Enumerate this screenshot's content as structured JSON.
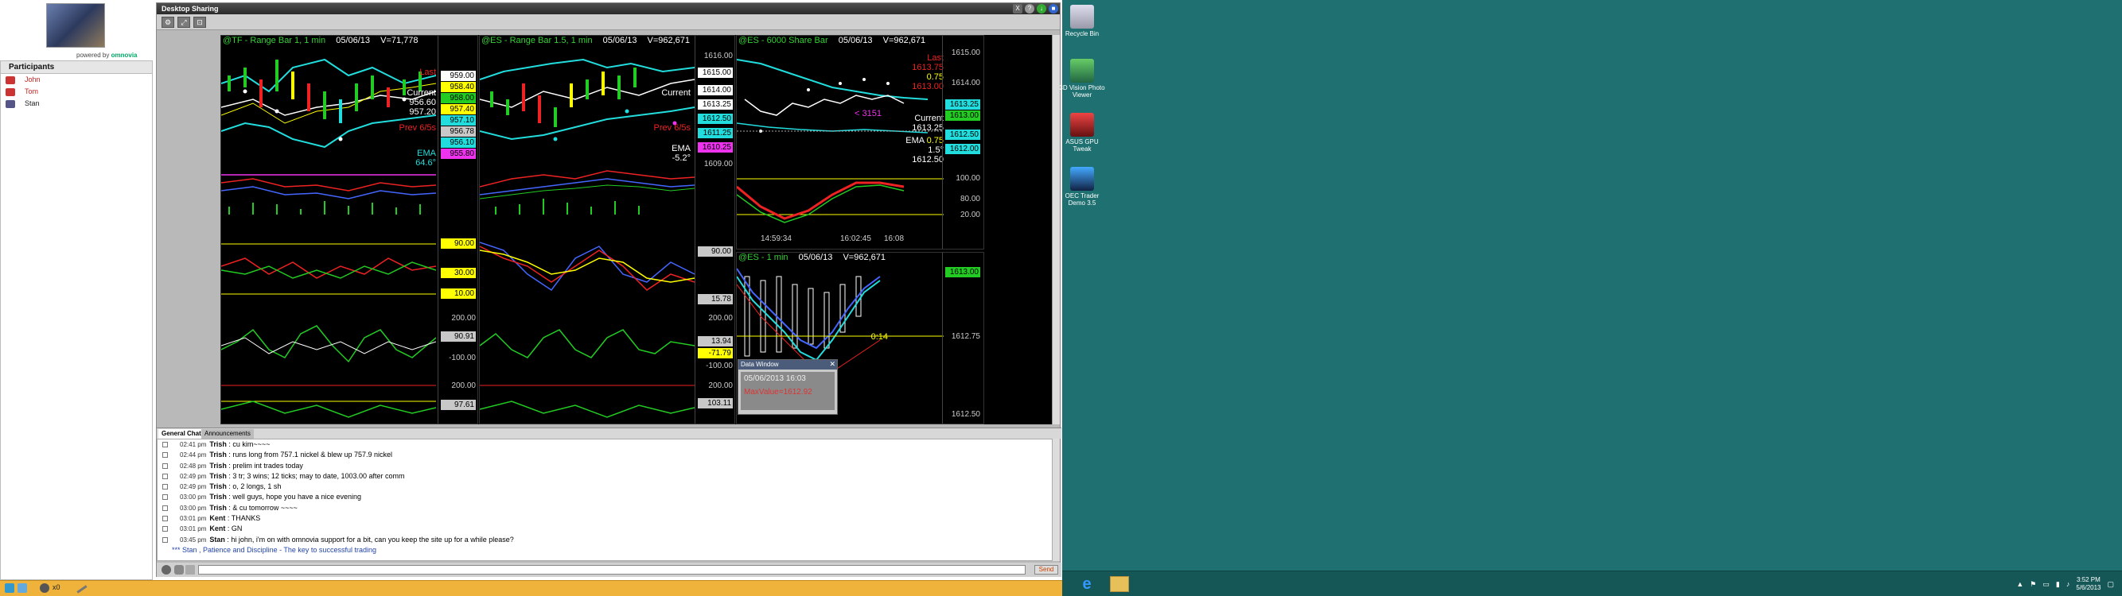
{
  "app": {
    "powered_prefix": "powered by",
    "powered_brand": "omnovia",
    "participants_title": "Participants",
    "participants": [
      {
        "name": "John",
        "color": "#cc2222"
      },
      {
        "name": "Tom",
        "color": "#cc2222"
      },
      {
        "name": "Stan",
        "color": "#222222"
      }
    ]
  },
  "share": {
    "title": "Desktop Sharing",
    "controls": [
      "X",
      "?",
      "↓",
      "■"
    ]
  },
  "charts": {
    "tf": {
      "name": "@TF - Range Bar 1, 1 min",
      "date": "05/06/13",
      "volume": "V=71,778",
      "last_label": "Last",
      "current_label": "Current",
      "current_values": [
        "956.60",
        "957.20"
      ],
      "prev_label": "Prev 6/5s",
      "ema_label": "EMA",
      "ema_value": "64.6°",
      "price_tags": [
        {
          "value": "959.00",
          "bg": "#ffffff"
        },
        {
          "value": "958.40",
          "bg": "#ffff00"
        },
        {
          "value": "958.00",
          "bg": "#22cc22"
        },
        {
          "value": "957.40",
          "bg": "#ffff00"
        },
        {
          "value": "957.10",
          "bg": "#22dddd"
        },
        {
          "value": "956.78",
          "bg": "#c8c8c8"
        },
        {
          "value": "956.10",
          "bg": "#22dddd"
        },
        {
          "value": "955.80",
          "bg": "#ee33ee"
        }
      ],
      "osc_tags": [
        {
          "value": "90.00",
          "bg": "#ffff00"
        },
        {
          "value": "30.00",
          "bg": "#ffff00"
        },
        {
          "value": "10.00",
          "bg": "#ffff00"
        }
      ],
      "osc_labels": [
        "200.00",
        "90.91",
        "-100.00",
        "200.00",
        "97.61"
      ]
    },
    "es_range": {
      "name": "@ES - Range Bar 1.5, 1 min",
      "date": "05/06/13",
      "volume": "V=962,671",
      "current_label": "Current",
      "prev_label": "Prev 6/5s",
      "ema_label": "EMA",
      "ema_value": "-5.2°",
      "axis_labels": [
        "1616.00",
        "1609.00"
      ],
      "price_tags": [
        {
          "value": "1615.00",
          "bg": "#ffffff"
        },
        {
          "value": "1614.00",
          "bg": "#ffffff"
        },
        {
          "value": "1613.25",
          "bg": "#ffffff"
        },
        {
          "value": "1612.50",
          "bg": "#22dddd"
        },
        {
          "value": "1611.25",
          "bg": "#22dddd"
        },
        {
          "value": "1610.25",
          "bg": "#ee33ee"
        }
      ],
      "osc_tags": [
        {
          "value": "90.00",
          "bg": "#c8c8c8"
        },
        {
          "value": "15.78",
          "bg": "#c8c8c8"
        },
        {
          "value": "13.94",
          "bg": "#c8c8c8"
        },
        {
          "value": "-71.79",
          "bg": "#ffff00"
        }
      ],
      "osc_labels": [
        "200.00",
        "-100.00",
        "200.00",
        "103.11"
      ]
    },
    "es_share": {
      "name": "@ES - 6000 Share Bar",
      "date": "05/06/13",
      "volume": "V=962,671",
      "last_label": "Last",
      "last_value": "1613.75",
      "last_change": "0.75",
      "last_prior": "1613.00",
      "tick_label": "< 3151",
      "current_label": "Current",
      "current_value": "1613.25",
      "ema_label": "EMA",
      "ema_change": "0.75",
      "ema_angle": "1.5°",
      "ema_value": "1612.50",
      "axis_labels": [
        "1615.00",
        "1614.00"
      ],
      "price_tags": [
        {
          "value": "1613.25",
          "bg": "#22dddd"
        },
        {
          "value": "1613.00",
          "bg": "#22cc22"
        },
        {
          "value": "1612.50",
          "bg": "#22dddd"
        },
        {
          "value": "1612.00",
          "bg": "#22dddd"
        }
      ],
      "osc_labels": [
        "100.00",
        "80.00",
        "20.00"
      ],
      "time_labels": [
        "14:59:34",
        "16:02:45",
        "16:08"
      ]
    },
    "es_1min": {
      "name": "@ES - 1 min",
      "date": "05/06/13",
      "volume": "V=962,671",
      "tag": "1613.00",
      "countdown": "0:14",
      "axis_labels": [
        "1612.75",
        "1612.50"
      ]
    }
  },
  "dialog": {
    "title": "Data Window",
    "date_line": "05/06/2013 16:03",
    "value_line": "MaxValue=1612.92"
  },
  "chat": {
    "tabs": [
      "General Chat",
      "Announcements"
    ],
    "messages": [
      {
        "time": "02:41 pm",
        "who": "Trish",
        "text": ": cu kim~~~~"
      },
      {
        "time": "02:44 pm",
        "who": "Trish",
        "text": ": runs long from 757.1 nickel & blew up 757.9 nickel"
      },
      {
        "time": "02:48 pm",
        "who": "Trish",
        "text": ": prelim int trades today"
      },
      {
        "time": "02:49 pm",
        "who": "Trish",
        "text": ": 3 tr; 3 wins; 12 ticks; may to date, 1003.00 after comm"
      },
      {
        "time": "02:49 pm",
        "who": "Trish",
        "text": ": o, 2 longs, 1 sh"
      },
      {
        "time": "03:00 pm",
        "who": "Trish",
        "text": ": well guys, hope you have a nice evening"
      },
      {
        "time": "03:00 pm",
        "who": "Trish",
        "text": ": & cu tomorrow ~~~~"
      },
      {
        "time": "03:01 pm",
        "who": "Kent",
        "text": ": THANKS"
      },
      {
        "time": "03:01 pm",
        "who": "Kent",
        "text": ": GN"
      },
      {
        "time": "03:45 pm",
        "who": "Stan",
        "text": ": hi john, i'm on with omnovia support for a bit, can you keep the site up for a while please?"
      }
    ],
    "banner": "*** Stan , Patience and Discipline - The key to successful trading",
    "send_label": "Send"
  },
  "taskbar_left": {
    "items": [
      "x0"
    ]
  },
  "desktop_icons": [
    {
      "label": "Recycle Bin",
      "color": "#9ab"
    },
    {
      "label": "3D Vision Photo Viewer",
      "color": "#3a7"
    },
    {
      "label": "ASUS GPU Tweak",
      "color": "#c33"
    },
    {
      "label": "OEC Trader Demo 3.5",
      "color": "#36c"
    }
  ],
  "tray": {
    "time": "3:52 PM",
    "date": "5/6/2013"
  }
}
